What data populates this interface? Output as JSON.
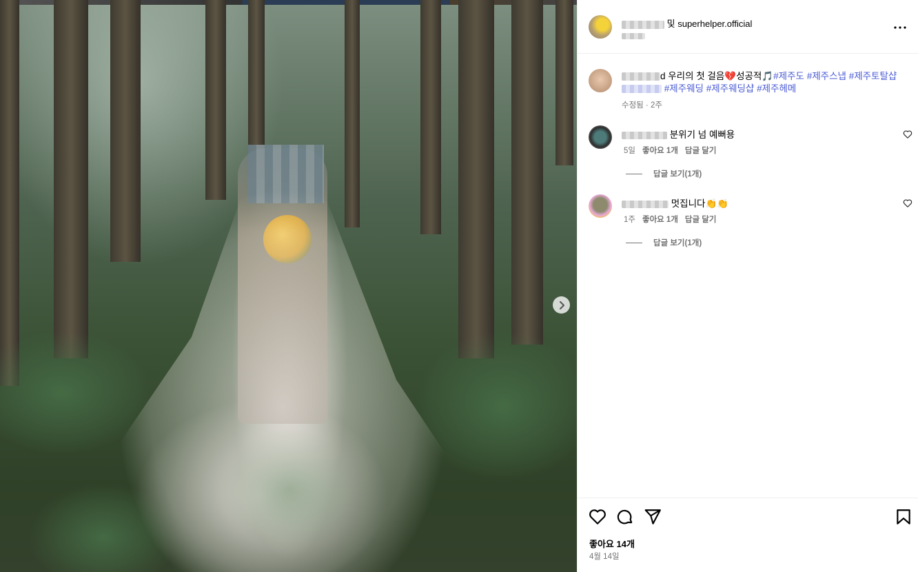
{
  "header": {
    "connector": "및",
    "coauthor": "superhelper.official"
  },
  "caption": {
    "text_start": "d 우리의 첫 걸음",
    "heart_emoji": "💔",
    "text_mid": "성공적",
    "music_emoji": "🎵",
    "tags_line1": [
      "#제주도",
      "#제주스냅",
      "#제주토탈샵"
    ],
    "tags_line2": [
      "#제주웨딩",
      "#제주웨딩샵",
      "#제주헤메"
    ],
    "meta": "수정됨 · 2주"
  },
  "comments": [
    {
      "text": "분위기 넘 예뻐용",
      "time": "5일",
      "likes": "좋아요 1개",
      "reply": "답글 달기",
      "view_replies": "답글 보기(1개)"
    },
    {
      "text": "멋집니다👏👏",
      "time": "1주",
      "likes": "좋아요 1개",
      "reply": "답글 달기",
      "view_replies": "답글 보기(1개)"
    }
  ],
  "footer": {
    "likes": "좋아요 14개",
    "date": "4월 14일"
  },
  "icons": {
    "like": "heart-icon",
    "comment": "comment-icon",
    "share": "send-icon",
    "save": "bookmark-icon",
    "more": "more-icon",
    "next": "chevron-right-icon"
  },
  "colors": {
    "hashtag": "#4a5bd4",
    "meta": "#737373"
  }
}
